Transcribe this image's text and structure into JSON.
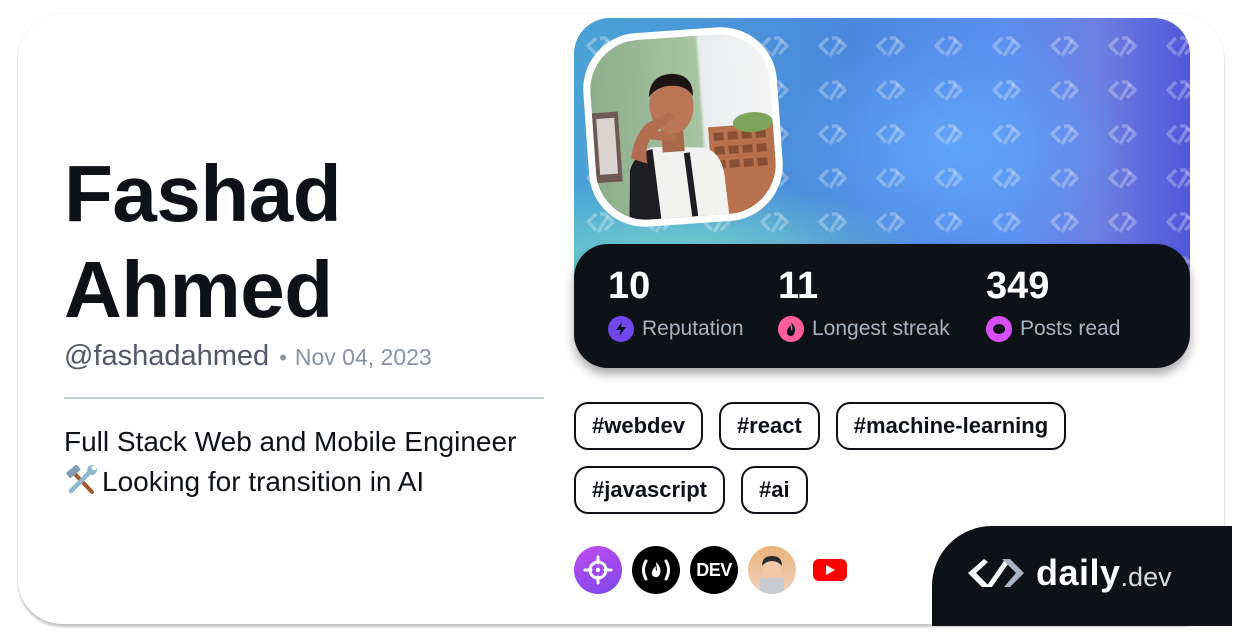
{
  "profile": {
    "name": "Fashad Ahmed",
    "handle": "@fashadahmed",
    "separator": "•",
    "joined": "Nov 04, 2023",
    "bio_line1": "Full Stack Web and Mobile Engineer",
    "bio_line2": "Looking for transition in AI",
    "bio_emoji": "hammer-and-wrench"
  },
  "stats": [
    {
      "value": "10",
      "label": "Reputation",
      "icon": "lightning-icon",
      "color": "#7147ed"
    },
    {
      "value": "11",
      "label": "Longest streak",
      "icon": "flame-icon",
      "color": "#ff5e9a"
    },
    {
      "value": "349",
      "label": "Posts read",
      "icon": "eye-icon",
      "color": "#d94ff5"
    }
  ],
  "tags": [
    "#webdev",
    "#react",
    "#machine-learning",
    "#javascript",
    "#ai"
  ],
  "sources": [
    {
      "name": "crosshair-source",
      "color": "#a046f0"
    },
    {
      "name": "freecodecamp",
      "color": "#000000"
    },
    {
      "name": "dev-to",
      "label": "DEV",
      "color": "#000000"
    },
    {
      "name": "devsquad",
      "color": "#e8b27a"
    },
    {
      "name": "youtube",
      "color": "#ff0000"
    }
  ],
  "brand": {
    "daily": "daily",
    "dev": ".dev"
  },
  "colors": {
    "text_primary": "#0e1217",
    "text_secondary": "#525866",
    "text_tertiary": "#8b93a1",
    "stats_bg": "#0e1217",
    "stats_label": "#a8b3c4"
  }
}
